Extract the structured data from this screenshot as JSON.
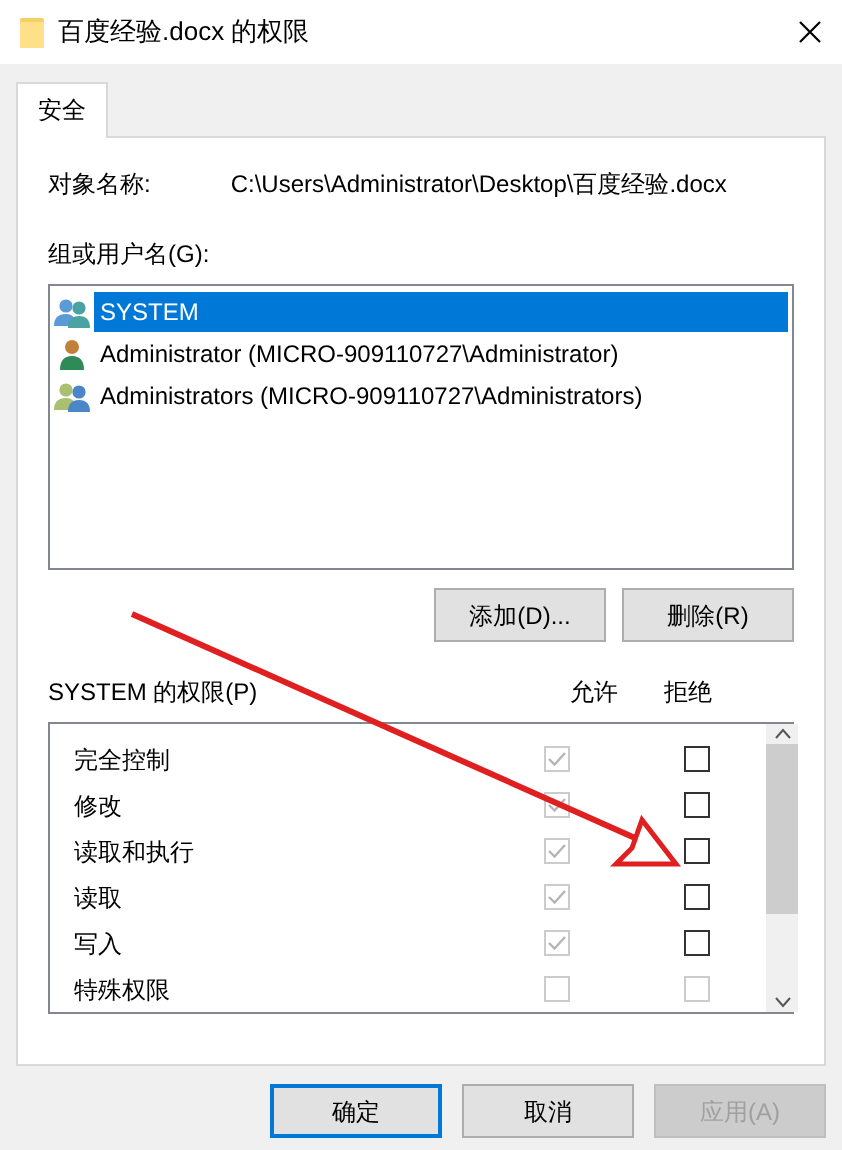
{
  "window": {
    "title": "百度经验.docx 的权限"
  },
  "tabs": [
    {
      "label": "安全",
      "selected": true
    }
  ],
  "object_name": {
    "label": "对象名称:",
    "value": "C:\\Users\\Administrator\\Desktop\\百度经验.docx"
  },
  "users": {
    "label": "组或用户名(G):",
    "items": [
      {
        "name": "SYSTEM",
        "kind": "group",
        "selected": true
      },
      {
        "name": "Administrator (MICRO-909110727\\Administrator)",
        "kind": "user",
        "selected": false
      },
      {
        "name": "Administrators (MICRO-909110727\\Administrators)",
        "kind": "admins",
        "selected": false
      }
    ]
  },
  "user_buttons": [
    "添加(D)...",
    "删除(R)"
  ],
  "permissions": {
    "label": "SYSTEM 的权限(P)",
    "allow_header": "允许",
    "deny_header": "拒绝",
    "rows": [
      {
        "name": "完全控制",
        "allow": {
          "checked": true,
          "disabled": true
        },
        "deny": {
          "checked": false,
          "disabled": false
        }
      },
      {
        "name": "修改",
        "allow": {
          "checked": true,
          "disabled": true
        },
        "deny": {
          "checked": false,
          "disabled": false
        }
      },
      {
        "name": "读取和执行",
        "allow": {
          "checked": true,
          "disabled": true
        },
        "deny": {
          "checked": false,
          "disabled": false
        }
      },
      {
        "name": "读取",
        "allow": {
          "checked": true,
          "disabled": true
        },
        "deny": {
          "checked": false,
          "disabled": false
        }
      },
      {
        "name": "写入",
        "allow": {
          "checked": true,
          "disabled": true
        },
        "deny": {
          "checked": false,
          "disabled": false
        }
      },
      {
        "name": "特殊权限",
        "allow": {
          "checked": false,
          "disabled": true
        },
        "deny": {
          "checked": false,
          "disabled": true
        }
      }
    ]
  },
  "footer_buttons": [
    {
      "label": "确定",
      "default": true,
      "disabled": false
    },
    {
      "label": "取消",
      "default": false,
      "disabled": false
    },
    {
      "label": "应用(A)",
      "default": false,
      "disabled": true
    }
  ]
}
